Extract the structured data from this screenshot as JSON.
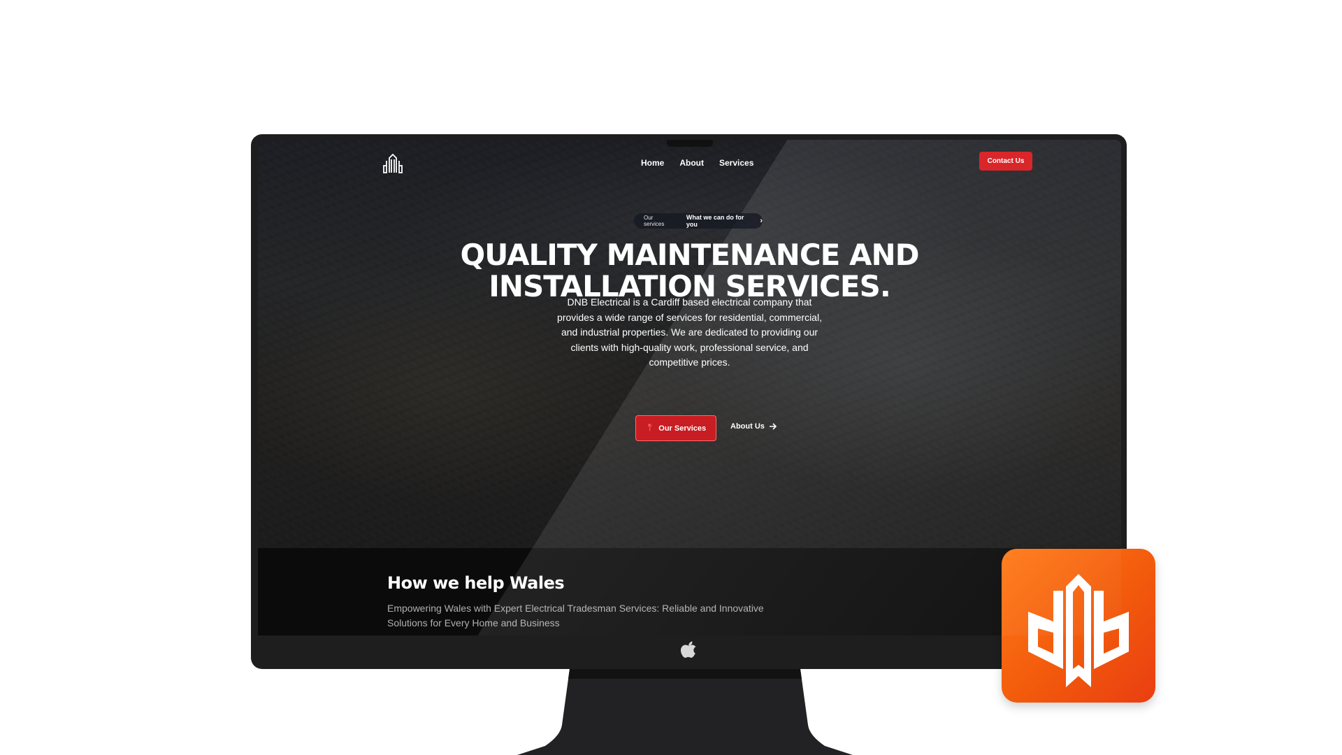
{
  "nav": {
    "links": [
      {
        "label": "Home"
      },
      {
        "label": "About"
      },
      {
        "label": "Services"
      }
    ],
    "contact_label": "Contact Us"
  },
  "hero": {
    "pill_tag": "Our services",
    "pill_text": "What we can do for you",
    "headline_line1": "QUALITY MAINTENANCE AND",
    "headline_line2": "INSTALLATION SERVICES.",
    "intro": "DNB Electrical is a Cardiff based electrical company that provides a wide range of services for residential, commercial, and industrial properties. We are dedicated to providing our clients with high-quality work, professional service, and competitive prices.",
    "cta_primary": "Our Services",
    "cta_secondary": "About Us"
  },
  "section": {
    "title": "How we help Wales",
    "subtitle": "Empowering Wales with Expert Electrical Tradesman Services: Reliable and Innovative Solutions for Every Home and Business"
  },
  "colors": {
    "accent_red": "#d9262a",
    "tile_orange": "#f25a0c"
  },
  "icons": {
    "brand": "dnb-logo-icon",
    "chin": "apple-logo-icon",
    "app": "dnb-app-icon"
  }
}
